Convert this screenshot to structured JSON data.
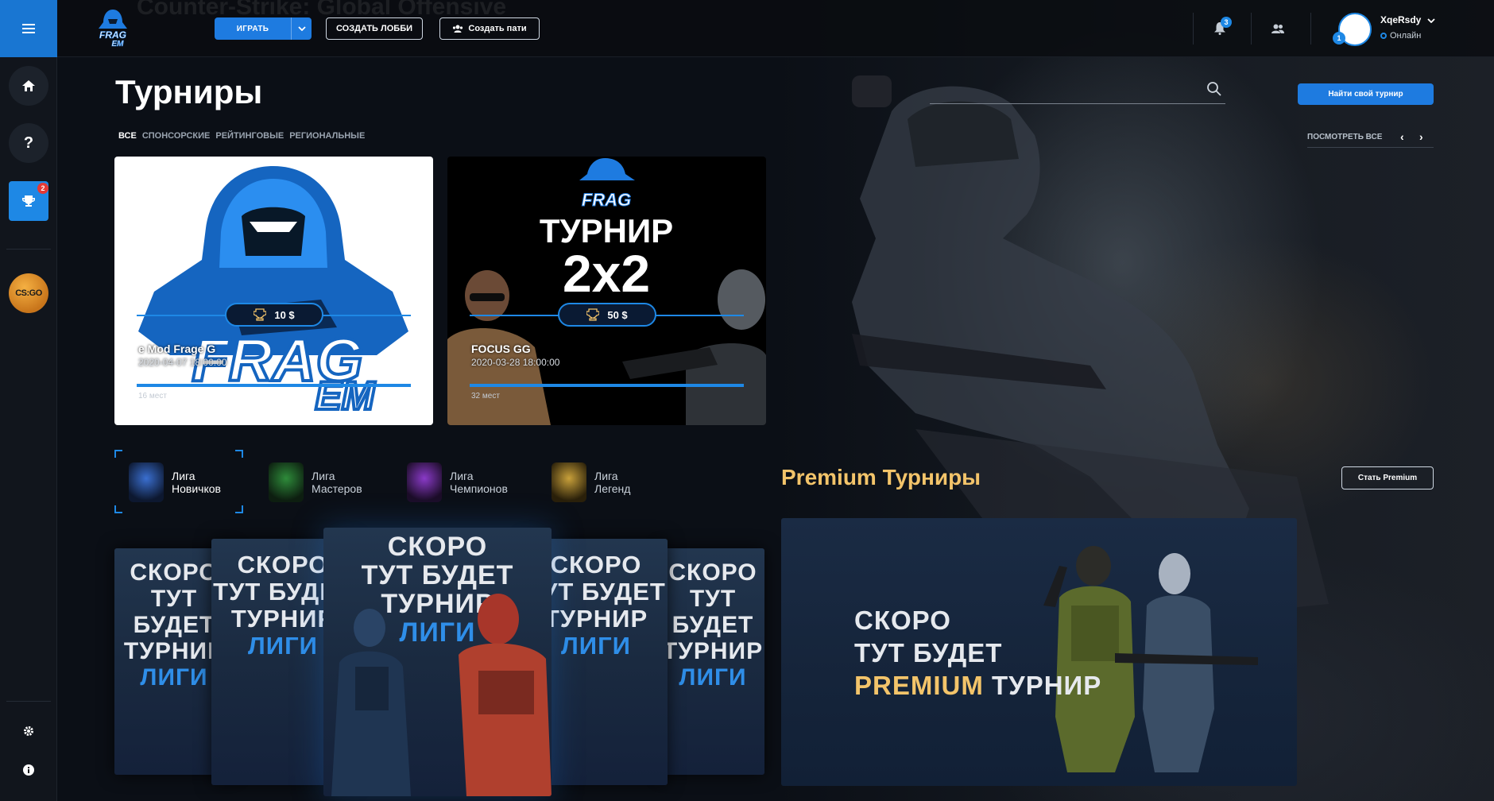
{
  "topbar": {
    "bg_title": "Counter-Strike: Global Offensive",
    "play_label": "ИГРАТЬ",
    "create_lobby_label": "СОЗДАТЬ ЛОББИ",
    "create_party_label": "Создать пати",
    "notifications_count": "3",
    "user": {
      "name": "XqeRsdy",
      "status": "Онлайн",
      "avatar_badge": "1"
    }
  },
  "sidebar": {
    "tournaments_badge": "2",
    "game_label": "CS:GO"
  },
  "main": {
    "title": "Турниры",
    "search_placeholder": "",
    "find_button": "Найти свой турнир",
    "filters": [
      "ВСЕ",
      "СПОНСОРСКИЕ",
      "РЕЙТИНГОВЫЕ",
      "РЕГИОНАЛЬНЫЕ"
    ],
    "view_all": "ПОСМОТРЕТЬ ВСЕ",
    "prev_arrow": "‹",
    "next_arrow": "›"
  },
  "tournaments": [
    {
      "name": "e Mod Frage G",
      "date": "2020-04-07 18:00:00",
      "prize": "10 $",
      "spots": "16 мест"
    },
    {
      "name": "FOCUS GG",
      "date": "2020-03-28 18:00:00",
      "prize": "50 $",
      "spots": "32 мест",
      "banner_line1": "ТУРНИР",
      "banner_line2": "2x2"
    }
  ],
  "leagues": [
    {
      "line1": "Лига",
      "line2": "Новичков",
      "emblem": "PRIMARY",
      "color": "#3a6fd0"
    },
    {
      "line1": "Лига",
      "line2": "Мастеров",
      "emblem": "MASTERS",
      "color": "#2e8b3a"
    },
    {
      "line1": "Лига",
      "line2": "Чемпионов",
      "emblem": "CHAMPION",
      "color": "#8a3ac8"
    },
    {
      "line1": "Лига",
      "line2": "Легенд",
      "emblem": "LEGEND",
      "color": "#c8a03a"
    }
  ],
  "league_card": {
    "line1": "СКОРО",
    "line2": "ТУТ БУДЕТ",
    "line3": "ТУРНИР",
    "line4": "ЛИГИ"
  },
  "premium": {
    "title": "Premium Турниры",
    "button": "Стать Premium",
    "banner_line1": "СКОРО",
    "banner_line2": "ТУТ БУДЕТ",
    "banner_gold": "PREMIUM",
    "banner_rest": "ТУРНИР"
  },
  "logo_text": {
    "line1": "FRAG",
    "line2": "EM"
  },
  "colors": {
    "accent": "#1e88e5",
    "gold": "#f3c46a",
    "badge": "#e53935"
  }
}
